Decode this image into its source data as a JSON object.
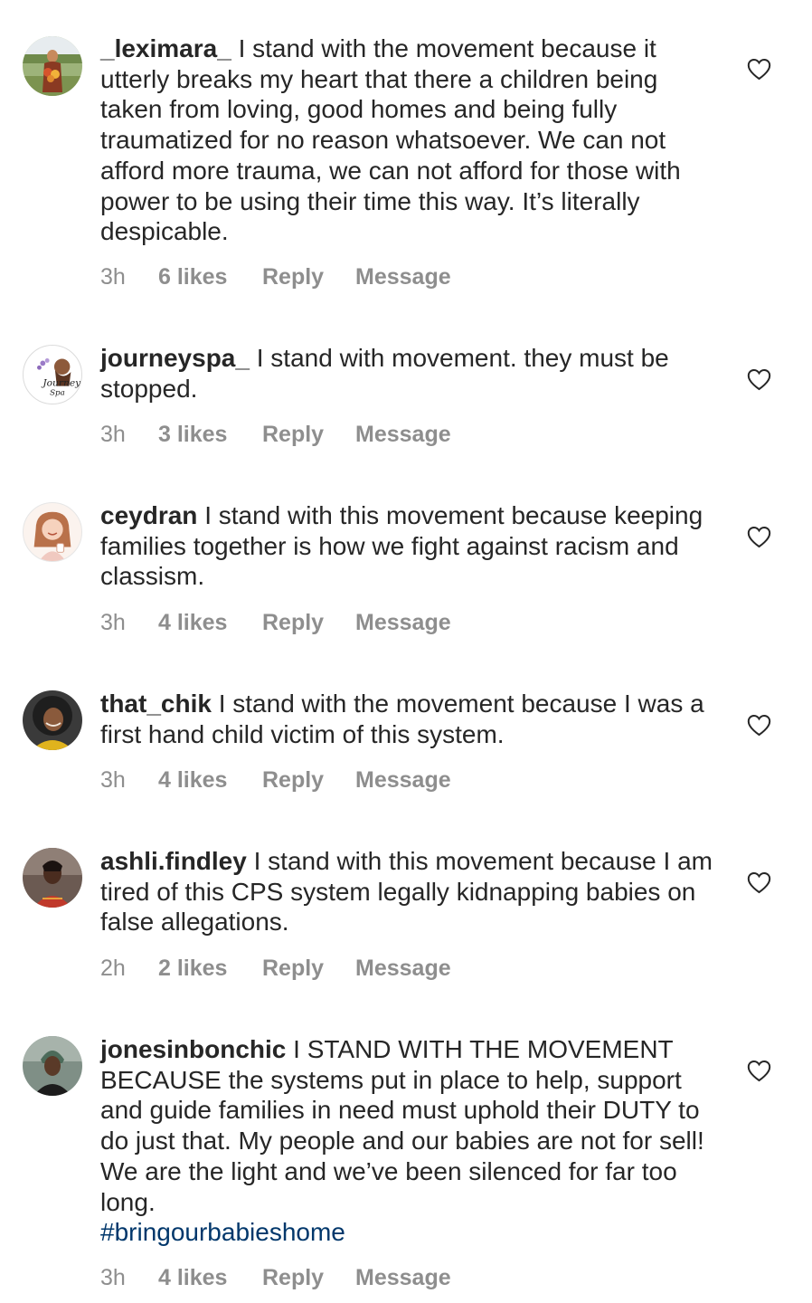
{
  "comments": [
    {
      "username": "_leximara_",
      "text": "I stand with the movement because it utterly breaks my heart  that there a children being taken from loving, good homes and being fully traumatized for no reason whatsoever. We can not afford more trauma, we can not afford for those with power to be using their time this way. It’s literally despicable.",
      "hashtag": "",
      "time": "3h",
      "likes": "6 likes",
      "reply": "Reply",
      "message": "Message",
      "avatar_icon": "woman-outdoors-photo"
    },
    {
      "username": "journeyspa_",
      "text": "I stand with movement. they must be stopped.",
      "hashtag": "",
      "time": "3h",
      "likes": "3 likes",
      "reply": "Reply",
      "message": "Message",
      "avatar_icon": "journey-spa-logo"
    },
    {
      "username": "ceydran",
      "text": "I stand with this movement because keeping families together is how we fight against racism and classism.",
      "hashtag": "",
      "time": "3h",
      "likes": "4 likes",
      "reply": "Reply",
      "message": "Message",
      "avatar_icon": "illustrated-woman-avatar"
    },
    {
      "username": "that_chik",
      "text": "I stand with the movement because I was a first hand child victim of this system.",
      "hashtag": "",
      "time": "3h",
      "likes": "4 likes",
      "reply": "Reply",
      "message": "Message",
      "avatar_icon": "woman-portrait-photo"
    },
    {
      "username": "ashli.findley",
      "text": "I stand with this movement because I am tired of this CPS system legally kidnapping babies on false allegations.",
      "hashtag": "",
      "time": "2h",
      "likes": "2 likes",
      "reply": "Reply",
      "message": "Message",
      "avatar_icon": "woman-portrait-photo"
    },
    {
      "username": "jonesinbonchic",
      "text": "I STAND WITH THE MOVEMENT BECAUSE the systems put in place to help, support and guide families in need must uphold their DUTY to do just that. My people and our babies are not for sell! We are the light and we’ve been silenced for far too long.",
      "hashtag": "#bringourbabieshome",
      "time": "3h",
      "likes": "4 likes",
      "reply": "Reply",
      "message": "Message",
      "avatar_icon": "woman-headwrap-photo"
    }
  ],
  "colors": {
    "text": "#262626",
    "meta": "#8e8e8e",
    "hashtag": "#00376b"
  }
}
